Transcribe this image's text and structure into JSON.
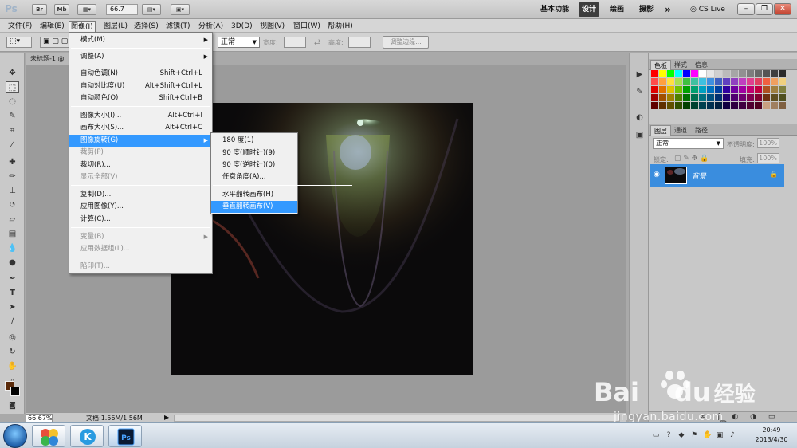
{
  "appbar": {
    "logo": "Ps",
    "bridge": "Br",
    "minibridge": "Mb",
    "zoom": "66.7",
    "workspaces": [
      "基本功能",
      "设计",
      "绘画",
      "摄影"
    ],
    "active_workspace": "设计",
    "more": "»",
    "cslive": "CS Live"
  },
  "menubar": [
    "文件(F)",
    "编辑(E)",
    "图像(I)",
    "图层(L)",
    "选择(S)",
    "滤镜(T)",
    "分析(A)",
    "3D(D)",
    "视图(V)",
    "窗口(W)",
    "帮助(H)"
  ],
  "options": {
    "feather_label": "宽度:",
    "height_label": "高度:",
    "style_value": "正常",
    "refine_edge": "调整边缘..."
  },
  "document": {
    "tab_title": "未标题-1 @",
    "zoom_status": "66.67%",
    "doc_info": "文档:1.56M/1.56M"
  },
  "image_menu": {
    "items": [
      {
        "label": "模式(M)",
        "shortcut": "",
        "submenu": true,
        "disabled": false
      },
      {
        "label": "调整(A)",
        "shortcut": "",
        "submenu": true,
        "disabled": false
      },
      {
        "label": "自动色调(N)",
        "shortcut": "Shift+Ctrl+L",
        "submenu": false,
        "disabled": false
      },
      {
        "label": "自动对比度(U)",
        "shortcut": "Alt+Shift+Ctrl+L",
        "submenu": false,
        "disabled": false
      },
      {
        "label": "自动颜色(O)",
        "shortcut": "Shift+Ctrl+B",
        "submenu": false,
        "disabled": false
      },
      {
        "label": "图像大小(I)...",
        "shortcut": "Alt+Ctrl+I",
        "submenu": false,
        "disabled": false
      },
      {
        "label": "画布大小(S)...",
        "shortcut": "Alt+Ctrl+C",
        "submenu": false,
        "disabled": false
      },
      {
        "label": "图像旋转(G)",
        "shortcut": "",
        "submenu": true,
        "disabled": false,
        "highlighted": true
      },
      {
        "label": "裁剪(P)",
        "shortcut": "",
        "submenu": false,
        "disabled": true
      },
      {
        "label": "裁切(R)...",
        "shortcut": "",
        "submenu": false,
        "disabled": false
      },
      {
        "label": "显示全部(V)",
        "shortcut": "",
        "submenu": false,
        "disabled": true
      },
      {
        "label": "复制(D)...",
        "shortcut": "",
        "submenu": false,
        "disabled": false
      },
      {
        "label": "应用图像(Y)...",
        "shortcut": "",
        "submenu": false,
        "disabled": false
      },
      {
        "label": "计算(C)...",
        "shortcut": "",
        "submenu": false,
        "disabled": false
      },
      {
        "label": "变量(B)",
        "shortcut": "",
        "submenu": true,
        "disabled": true
      },
      {
        "label": "应用数据组(L)...",
        "shortcut": "",
        "submenu": false,
        "disabled": true
      },
      {
        "label": "陷印(T)...",
        "shortcut": "",
        "submenu": false,
        "disabled": true
      }
    ]
  },
  "rotate_menu": {
    "items": [
      {
        "label": "180 度(1)"
      },
      {
        "label": "90 度(顺时针)(9)"
      },
      {
        "label": "90 度(逆时针)(0)"
      },
      {
        "label": "任意角度(A)..."
      },
      {
        "label": "水平翻转画布(H)"
      },
      {
        "label": "垂直翻转画布(V)",
        "highlighted": true
      }
    ]
  },
  "panels": {
    "color_tabs": [
      "色板",
      "样式",
      "信息"
    ],
    "layer_tabs": [
      "图层",
      "通道",
      "路径"
    ],
    "blend_mode": "正常",
    "opacity_label": "不透明度:",
    "opacity_value": "100%",
    "lock_label": "锁定:",
    "fill_label": "填充:",
    "fill_value": "100%",
    "layer_name": "背景"
  },
  "swatch_colors": [
    "#ff0000",
    "#ffff00",
    "#00ff00",
    "#00ffff",
    "#0000ff",
    "#ff00ff",
    "#ffffff",
    "#e6e6e6",
    "#d0d0d0",
    "#bbbbbb",
    "#a6a6a6",
    "#919191",
    "#7d7d7d",
    "#686868",
    "#545454",
    "#3f3f3f",
    "#2b2b2b",
    "#ff4b4b",
    "#ffa040",
    "#ffe040",
    "#a8e050",
    "#40c040",
    "#40c0a0",
    "#40c0e0",
    "#4090e0",
    "#4060c0",
    "#6040c0",
    "#9040c0",
    "#c040c0",
    "#e04090",
    "#e04060",
    "#f06040",
    "#f0a060",
    "#f0d080",
    "#e00000",
    "#e07000",
    "#e0c000",
    "#70c000",
    "#00a000",
    "#00a070",
    "#00a0c0",
    "#0070c0",
    "#0040a0",
    "#3000a0",
    "#7000a0",
    "#a000a0",
    "#c00070",
    "#c00040",
    "#b05020",
    "#a08040",
    "#808040",
    "#a00000",
    "#a05000",
    "#a08000",
    "#508000",
    "#007000",
    "#007050",
    "#007080",
    "#005080",
    "#003070",
    "#200070",
    "#500070",
    "#700070",
    "#800050",
    "#800030",
    "#703010",
    "#605020",
    "#505020",
    "#600000",
    "#603000",
    "#605000",
    "#305000",
    "#004000",
    "#004030",
    "#004050",
    "#003050",
    "#002040",
    "#100040",
    "#300040",
    "#400040",
    "#500030",
    "#500020",
    "#c8a080",
    "#a08060",
    "#806040"
  ],
  "taskbar": {
    "time": "20:49",
    "date": "2013/4/30"
  },
  "watermark": {
    "brand": "Bai",
    "brand_end": "du",
    "brand_cn": "经验",
    "url": "jingyan.baidu.com"
  }
}
